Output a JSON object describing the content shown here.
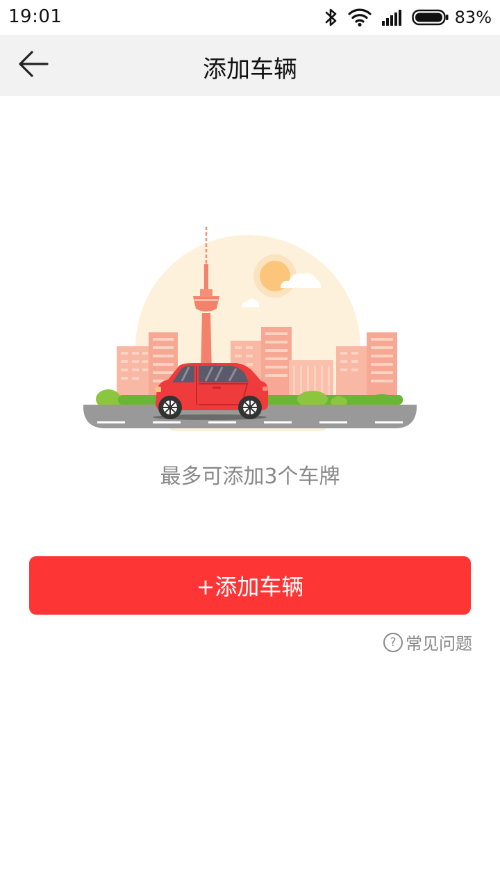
{
  "status_bar": {
    "time": "19:01",
    "battery_percent": "83%",
    "icons": [
      "bluetooth-icon",
      "wifi-icon",
      "signal-icon",
      "battery-icon"
    ]
  },
  "nav": {
    "title": "添加车辆",
    "back_icon": "arrow-left-icon"
  },
  "main": {
    "hint": "最多可添加3个车牌",
    "add_button_label": "+添加车辆",
    "faq_icon_glyph": "?",
    "faq_label": "常见问题"
  },
  "colors": {
    "accent": "#fd3535",
    "nav_bg": "#f2f2f2",
    "secondary_text": "#888888"
  }
}
